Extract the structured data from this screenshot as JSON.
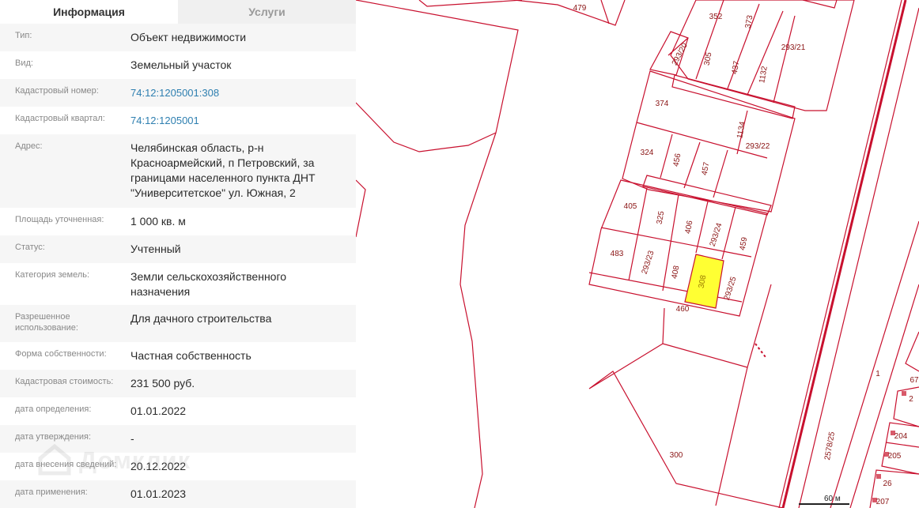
{
  "tabs": [
    {
      "label": "Информация",
      "active": true
    },
    {
      "label": "Услуги",
      "active": false
    }
  ],
  "info": [
    {
      "label": "Тип:",
      "value": [
        "Объект недвижимости"
      ]
    },
    {
      "label": "Вид:",
      "value": [
        "Земельный участок"
      ]
    },
    {
      "label": "Кадастровый номер:",
      "value": [
        "74:12:1205001:308"
      ],
      "link": true
    },
    {
      "label": "Кадастровый квартал:",
      "value": [
        "74:12:1205001"
      ],
      "link": true
    },
    {
      "label": "Адрес:",
      "value": [
        "Челябинская область, р-н",
        "Красноармейский, п Петровский, за",
        "границами населенного пункта ДНТ",
        "\"Университетское\" ул. Южная, 2"
      ]
    },
    {
      "label": "Площадь уточненная:",
      "value": [
        "1 000 кв. м"
      ]
    },
    {
      "label": "Статус:",
      "value": [
        "Учтенный"
      ]
    },
    {
      "label": "Категория земель:",
      "value": [
        "Земли сельскохозяйственного",
        "назначения"
      ]
    },
    {
      "label": "Разрешенное использование:",
      "value": [
        "Для дачного строительства"
      ]
    },
    {
      "label": "Форма собственности:",
      "value": [
        "Частная собственность"
      ]
    },
    {
      "label": "Кадастровая стоимость:",
      "value": [
        "231 500 руб."
      ]
    },
    {
      "label": "дата определения:",
      "value": [
        "01.01.2022"
      ]
    },
    {
      "label": "дата утверждения:",
      "value": [
        "-"
      ]
    },
    {
      "label": "дата внесения сведений:",
      "value": [
        "20.12.2022"
      ]
    },
    {
      "label": "дата применения:",
      "value": [
        "01.01.2023"
      ]
    }
  ],
  "watermark": "Домклик",
  "map": {
    "boundary_color": "#c8102e",
    "selected_fill": "#ffff33",
    "labels": [
      "479",
      "352",
      "373",
      "293/20",
      "305",
      "437",
      "1132",
      "293/21",
      "374",
      "1134",
      "293/22",
      "324",
      "456",
      "457",
      "405",
      "325",
      "406",
      "293/24",
      "459",
      "483",
      "293/23",
      "408",
      "308",
      "293/25",
      "460",
      "300",
      "1",
      "2578/25",
      "67",
      "2",
      "204",
      "205",
      "26",
      "207"
    ],
    "selected_label": "308",
    "scale_label": "60 м"
  }
}
